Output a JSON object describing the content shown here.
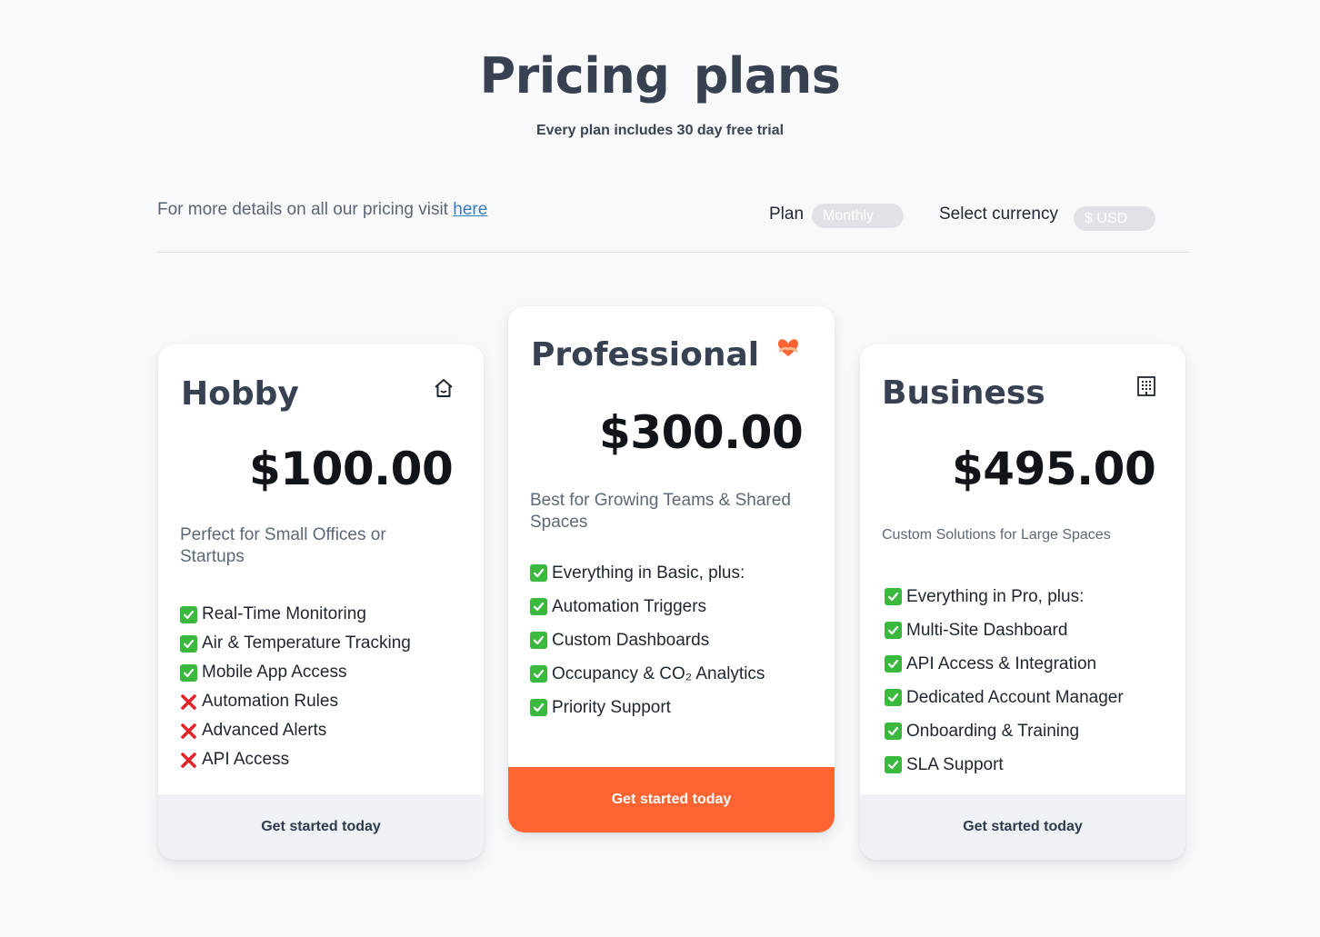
{
  "header": {
    "title": "Pricing plans",
    "subtitle": "Every plan includes 30 day free trial"
  },
  "toolbar": {
    "details_text": "For more details on all our pricing visit ",
    "details_link": "here",
    "plan_label": "Plan",
    "plan_value": "Monthly",
    "currency_label": "Select currency",
    "currency_value": "$ USD"
  },
  "colors": {
    "accent": "#fd6432",
    "check": "#3bb83e",
    "cross": "#e0242a",
    "cta_bg": "#eef1f5"
  },
  "plans": [
    {
      "name": "Hobby",
      "icon": "house-icon",
      "price": "$100.00",
      "description": "Perfect for Small Offices or Startups",
      "features": [
        {
          "text": "Real-Time Monitoring",
          "included": true
        },
        {
          "text": "Air & Temperature Tracking",
          "included": true
        },
        {
          "text": "Mobile App Access",
          "included": true
        },
        {
          "text": "Automation Rules",
          "included": false
        },
        {
          "text": "Advanced Alerts",
          "included": false
        },
        {
          "text": "API Access",
          "included": false
        }
      ],
      "cta": "Get started today"
    },
    {
      "name": "Professional",
      "icon": "heart-hands-icon",
      "price": "$300.00",
      "description": "Best for Growing Teams & Shared Spaces",
      "features": [
        {
          "text": "Everything in Basic, plus:",
          "included": true
        },
        {
          "text": "Automation Triggers",
          "included": true
        },
        {
          "text": "Custom Dashboards",
          "included": true
        },
        {
          "text": "Occupancy & CO₂ Analytics",
          "included": true
        },
        {
          "text": "Priority Support",
          "included": true
        }
      ],
      "cta": "Get started today"
    },
    {
      "name": "Business",
      "icon": "office-building-icon",
      "price": "$495.00",
      "description": "Custom Solutions for Large Spaces",
      "features": [
        {
          "text": "Everything in Pro, plus:",
          "included": true
        },
        {
          "text": "Multi-Site Dashboard",
          "included": true
        },
        {
          "text": "API Access & Integration",
          "included": true
        },
        {
          "text": "Dedicated Account Manager",
          "included": true
        },
        {
          "text": "Onboarding & Training",
          "included": true
        },
        {
          "text": "SLA Support",
          "included": true
        }
      ],
      "cta": "Get started today"
    }
  ]
}
